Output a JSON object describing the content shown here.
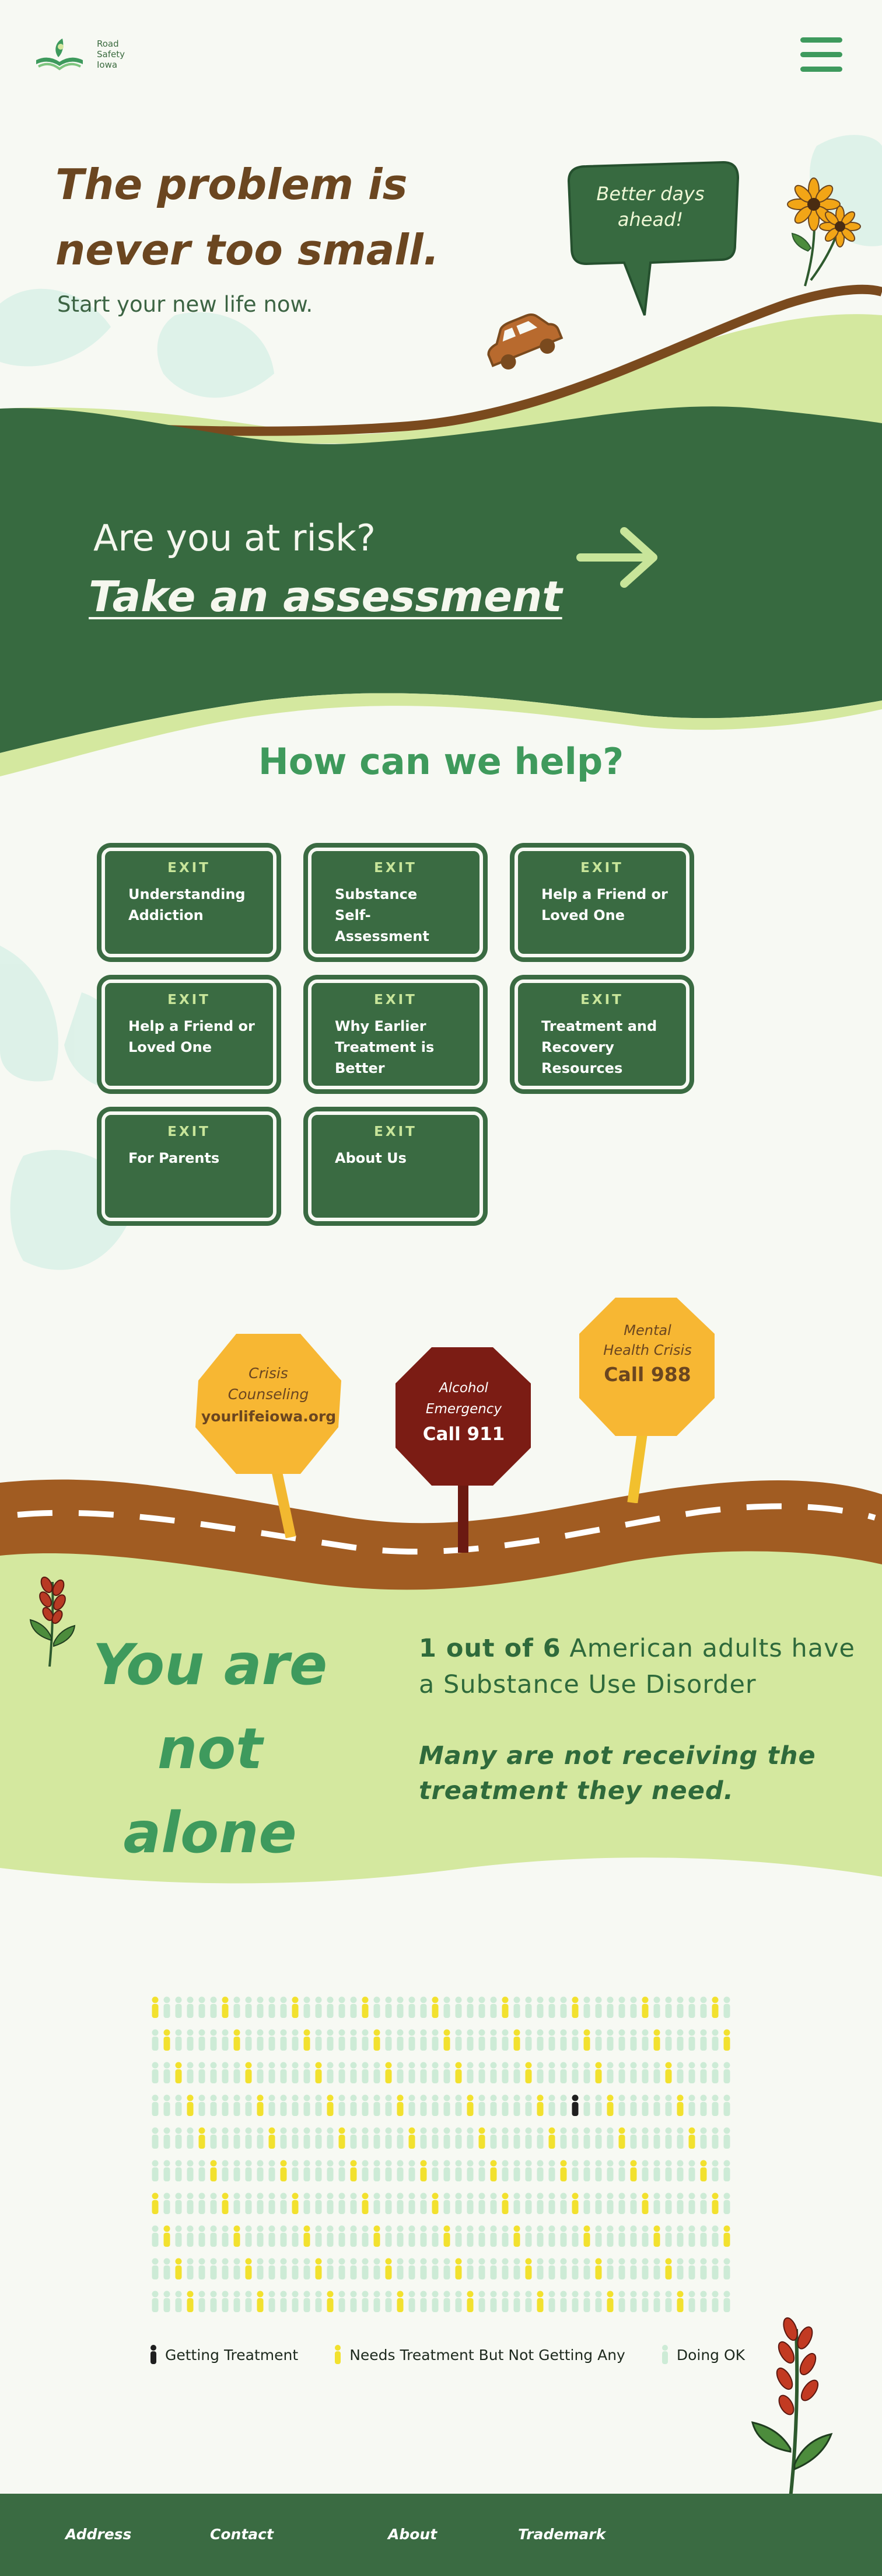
{
  "brand": {
    "logo_line1": "Road",
    "logo_line2": "Safety",
    "logo_line3": "Iowa"
  },
  "hero": {
    "title_line1": "The problem is",
    "title_line2": "never too small.",
    "subtitle": "Start your new life now.",
    "bubble_line1": "Better days",
    "bubble_line2": "ahead!"
  },
  "assessment": {
    "question": "Are you at risk?",
    "link": "Take an assessment"
  },
  "help": {
    "title": "How can we help?",
    "exit_label": "EXIT",
    "cards": [
      {
        "label": "Understanding Addiction"
      },
      {
        "label": "Substance Self-Assessment"
      },
      {
        "label": "Help a Friend or Loved One"
      },
      {
        "label": "Help a Friend or Loved One"
      },
      {
        "label": "Why Earlier Treatment is Better"
      },
      {
        "label": "Treatment and Recovery Resources"
      },
      {
        "label": "For Parents"
      },
      {
        "label": "About Us"
      }
    ]
  },
  "signs": {
    "crisis": {
      "line1": "Crisis",
      "line2": "Counseling",
      "line3": "yourlifeiowa.org"
    },
    "alcohol": {
      "line1": "Alcohol",
      "line2": "Emergency",
      "line3": "Call 911"
    },
    "mental": {
      "line1": "Mental",
      "line2": "Health Crisis",
      "line3": "Call 988"
    }
  },
  "alone": {
    "title_line1": "You are",
    "title_line2": "not alone",
    "stat_bold": "1 out of 6",
    "stat_rest": " American adults have a Substance Use Disorder",
    "stat2": "Many are not receiving the treatment they need."
  },
  "legend": {
    "getting": "Getting Treatment",
    "needs": "Needs Treatment But Not Getting Any",
    "ok": "Doing OK"
  },
  "colors": {
    "getting": "#1f1f1f",
    "needs": "#f2e12e",
    "ok": "#cdebd6"
  },
  "footer": {
    "address": "Address",
    "contact": "Contact",
    "about": "About",
    "trademark": "Trademark"
  }
}
